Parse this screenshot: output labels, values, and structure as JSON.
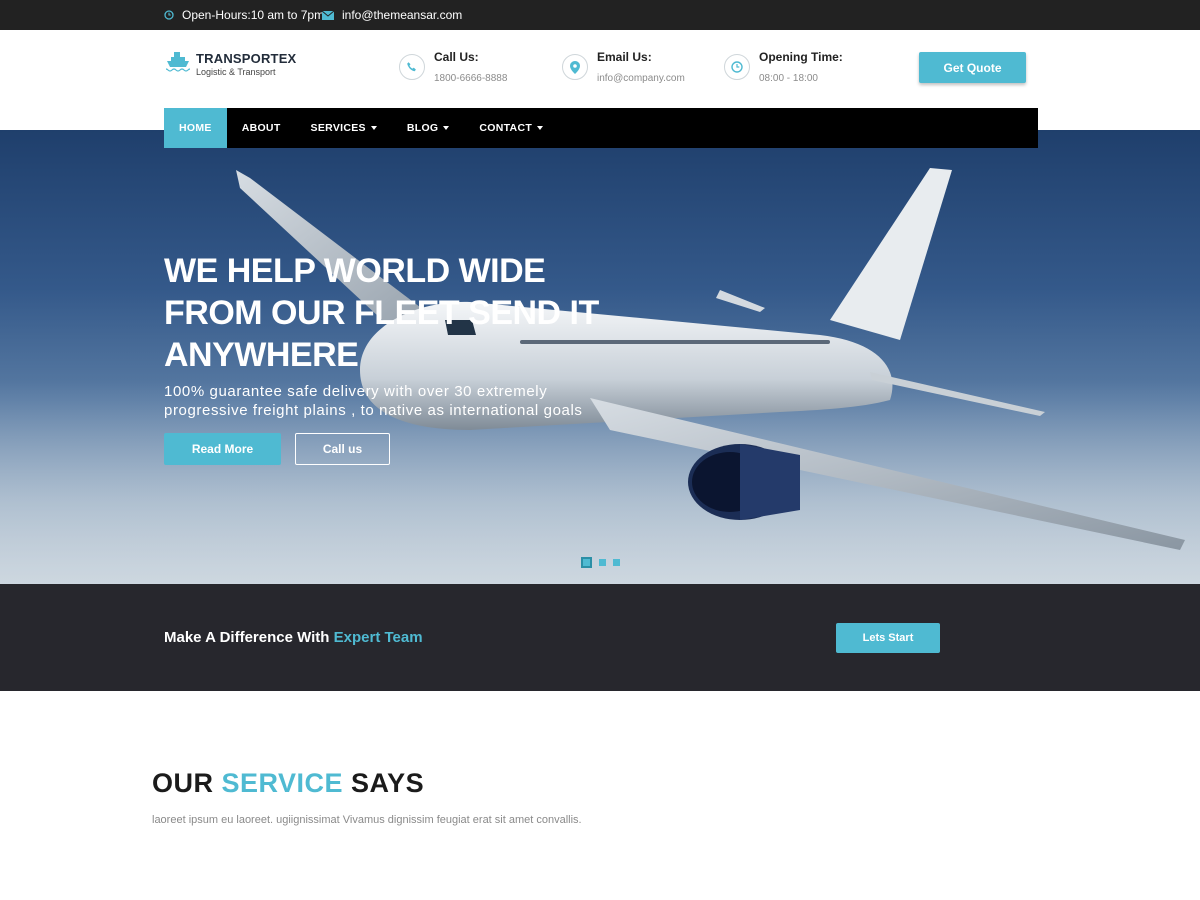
{
  "topbar": {
    "hours": "Open-Hours:10 am to 7pm",
    "email": "info@themeansar.com"
  },
  "header": {
    "logo_name": "TRANSPORTEX",
    "logo_tagline": "Logistic & Transport",
    "call_title": "Call Us:",
    "call_value": "1800-6666-8888",
    "email_title": "Email Us:",
    "email_value": "info@company.com",
    "time_title": "Opening Time:",
    "time_value": "08:00 - 18:00",
    "quote_label": "Get Quote"
  },
  "nav": {
    "items": [
      {
        "label": "HOME"
      },
      {
        "label": "ABOUT"
      },
      {
        "label": "SERVICES"
      },
      {
        "label": "BLOG"
      },
      {
        "label": "CONTACT"
      }
    ]
  },
  "hero": {
    "title_line1": "WE HELP WORLD WIDE",
    "title_line2": "FROM OUR FLEET SEND IT",
    "title_line3": "ANYWHERE",
    "subtitle_line1": "100% guarantee safe delivery with over 30 extremely",
    "subtitle_line2": "progressive freight plains , to native as international goals",
    "read_more": "Read More",
    "call_us": "Call us"
  },
  "band": {
    "text": "Make A Difference With ",
    "highlight": "Expert Team",
    "button": "Lets Start"
  },
  "service": {
    "title_part1": "OUR ",
    "title_highlight": "SERVICE",
    "title_part2": " SAYS",
    "subtitle": "laoreet ipsum eu laoreet. ugiignissimat Vivamus dignissim feugiat erat sit amet convallis."
  },
  "colors": {
    "accent": "#4fbad2",
    "dark": "#27272d",
    "nav_bg": "#000000",
    "topbar_bg": "#222222"
  },
  "icons": {
    "hours": "clock-icon",
    "email": "envelope-icon",
    "call": "phone-icon",
    "location": "map-pin-icon",
    "time": "clock-icon",
    "logo": "ship-icon"
  }
}
